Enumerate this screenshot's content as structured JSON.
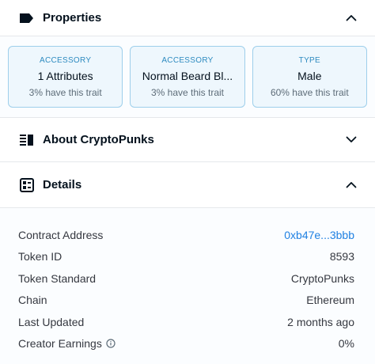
{
  "properties": {
    "title": "Properties",
    "traits": [
      {
        "type": "ACCESSORY",
        "value": "1 Attributes",
        "rarity": "3% have this trait"
      },
      {
        "type": "ACCESSORY",
        "value": "Normal Beard Bl...",
        "rarity": "3% have this trait"
      },
      {
        "type": "TYPE",
        "value": "Male",
        "rarity": "60% have this trait"
      }
    ]
  },
  "about": {
    "title": "About CryptoPunks"
  },
  "details": {
    "title": "Details",
    "rows": [
      {
        "label": "Contract Address",
        "value": "0xb47e...3bbb"
      },
      {
        "label": "Token ID",
        "value": "8593"
      },
      {
        "label": "Token Standard",
        "value": "CryptoPunks"
      },
      {
        "label": "Chain",
        "value": "Ethereum"
      },
      {
        "label": "Last Updated",
        "value": "2 months ago"
      },
      {
        "label": "Creator Earnings",
        "value": "0%"
      }
    ]
  },
  "colors": {
    "accent": "#2081e2",
    "trait_border": "#9ecfeb",
    "trait_bg": "#eef7fd"
  }
}
